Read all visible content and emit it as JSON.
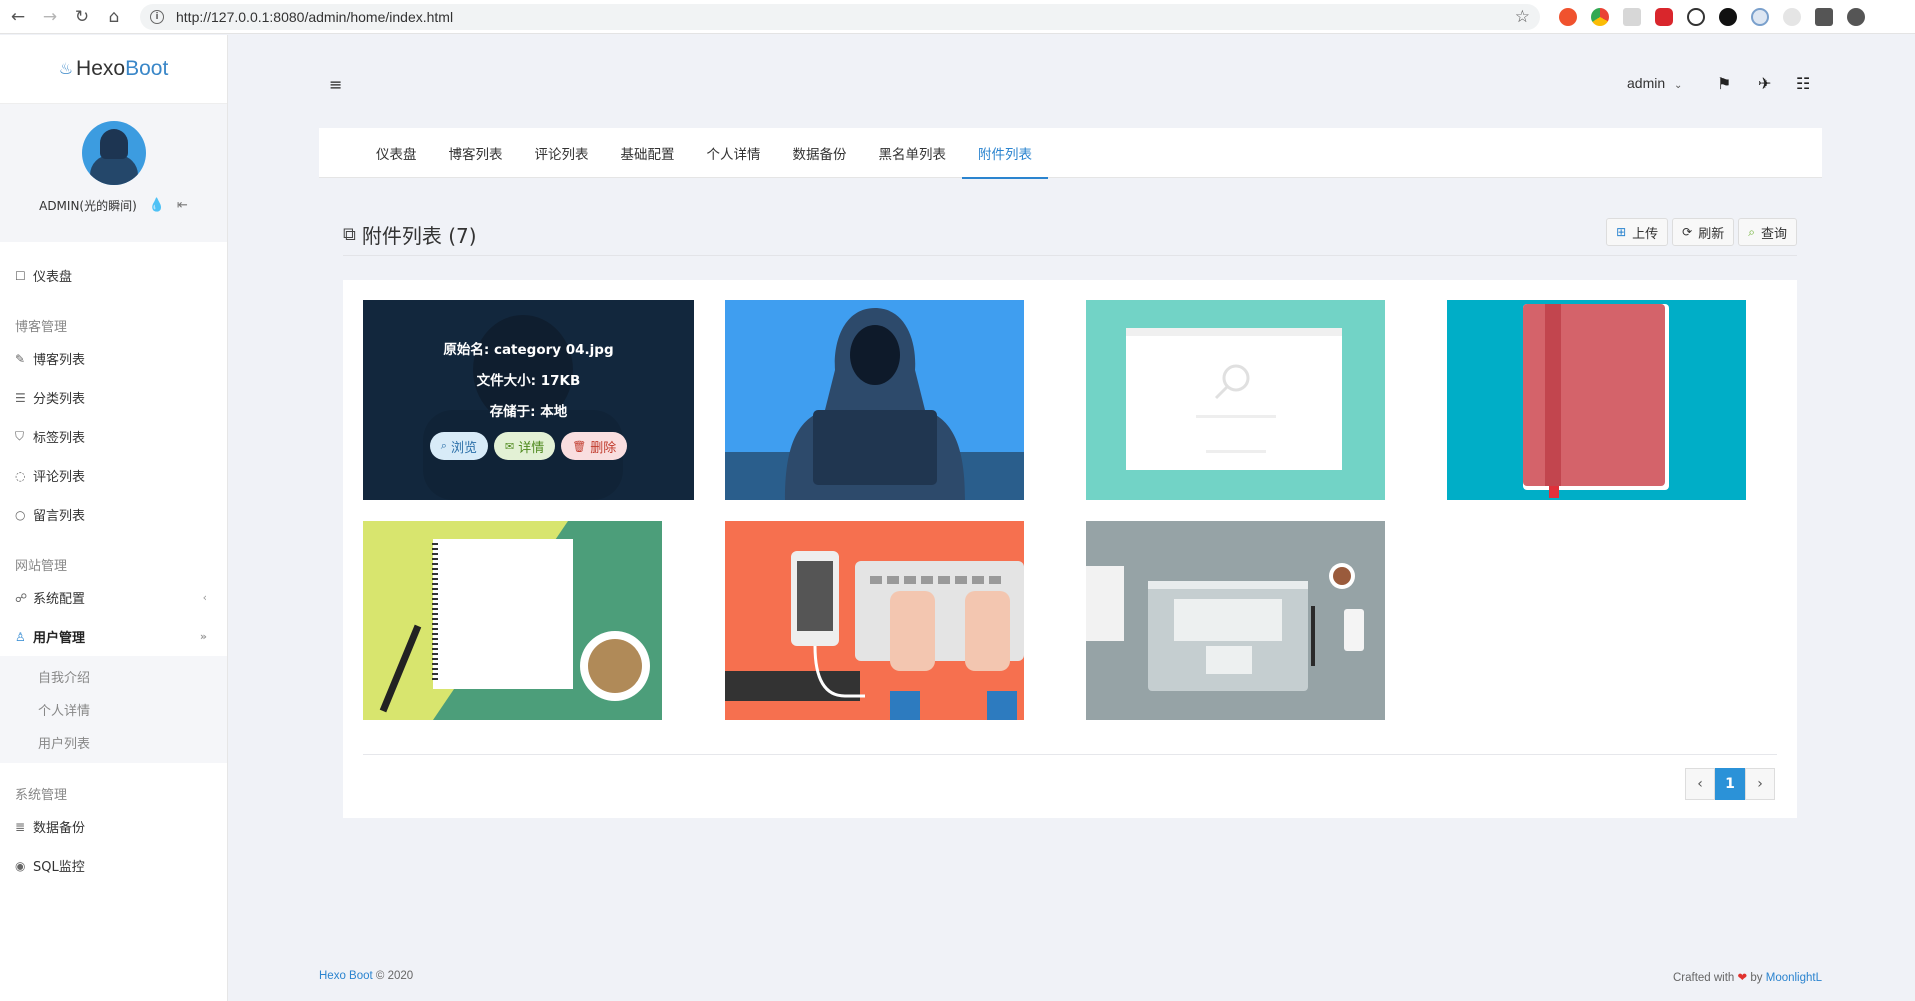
{
  "browser": {
    "url": "http://127.0.0.1:8080/admin/home/index.html"
  },
  "brand": {
    "part1": "Hexo",
    "part2": "Boot"
  },
  "profile": {
    "name": "ADMIN(光的瞬间)"
  },
  "sidebar": {
    "dashboard": "仪表盘",
    "group_blog": "博客管理",
    "blog_items": [
      "博客列表",
      "分类列表",
      "标签列表",
      "评论列表",
      "留言列表"
    ],
    "group_site": "网站管理",
    "system_config": "系统配置",
    "user_management": "用户管理",
    "user_sub_items": [
      "自我介绍",
      "个人详情",
      "用户列表"
    ],
    "group_system": "系统管理",
    "system_items": [
      "数据备份",
      "SQL监控"
    ]
  },
  "topbar": {
    "user": "admin"
  },
  "tabs": [
    "仪表盘",
    "博客列表",
    "评论列表",
    "基础配置",
    "个人详情",
    "数据备份",
    "黑名单列表",
    "附件列表"
  ],
  "page": {
    "title": "附件列表 (7)",
    "buttons": {
      "upload": "上传",
      "refresh": "刷新",
      "query": "查询"
    }
  },
  "hover_card": {
    "original_name": "原始名: category 04.jpg",
    "file_size": "文件大小: 17KB",
    "stored_at": "存储于: 本地",
    "browse": "浏览",
    "detail": "详情",
    "delete": "删除"
  },
  "pagination": {
    "prev": "‹",
    "current": "1",
    "next": "›"
  },
  "footer": {
    "left_link": "Hexo Boot",
    "left_suffix": "© 2020",
    "right_prefix": "Crafted with",
    "right_by": "by",
    "right_link": "MoonlightL"
  },
  "colors": {
    "accent": "#2b84cf",
    "pager_active": "#2b92d8",
    "heart": "#e0322e"
  }
}
